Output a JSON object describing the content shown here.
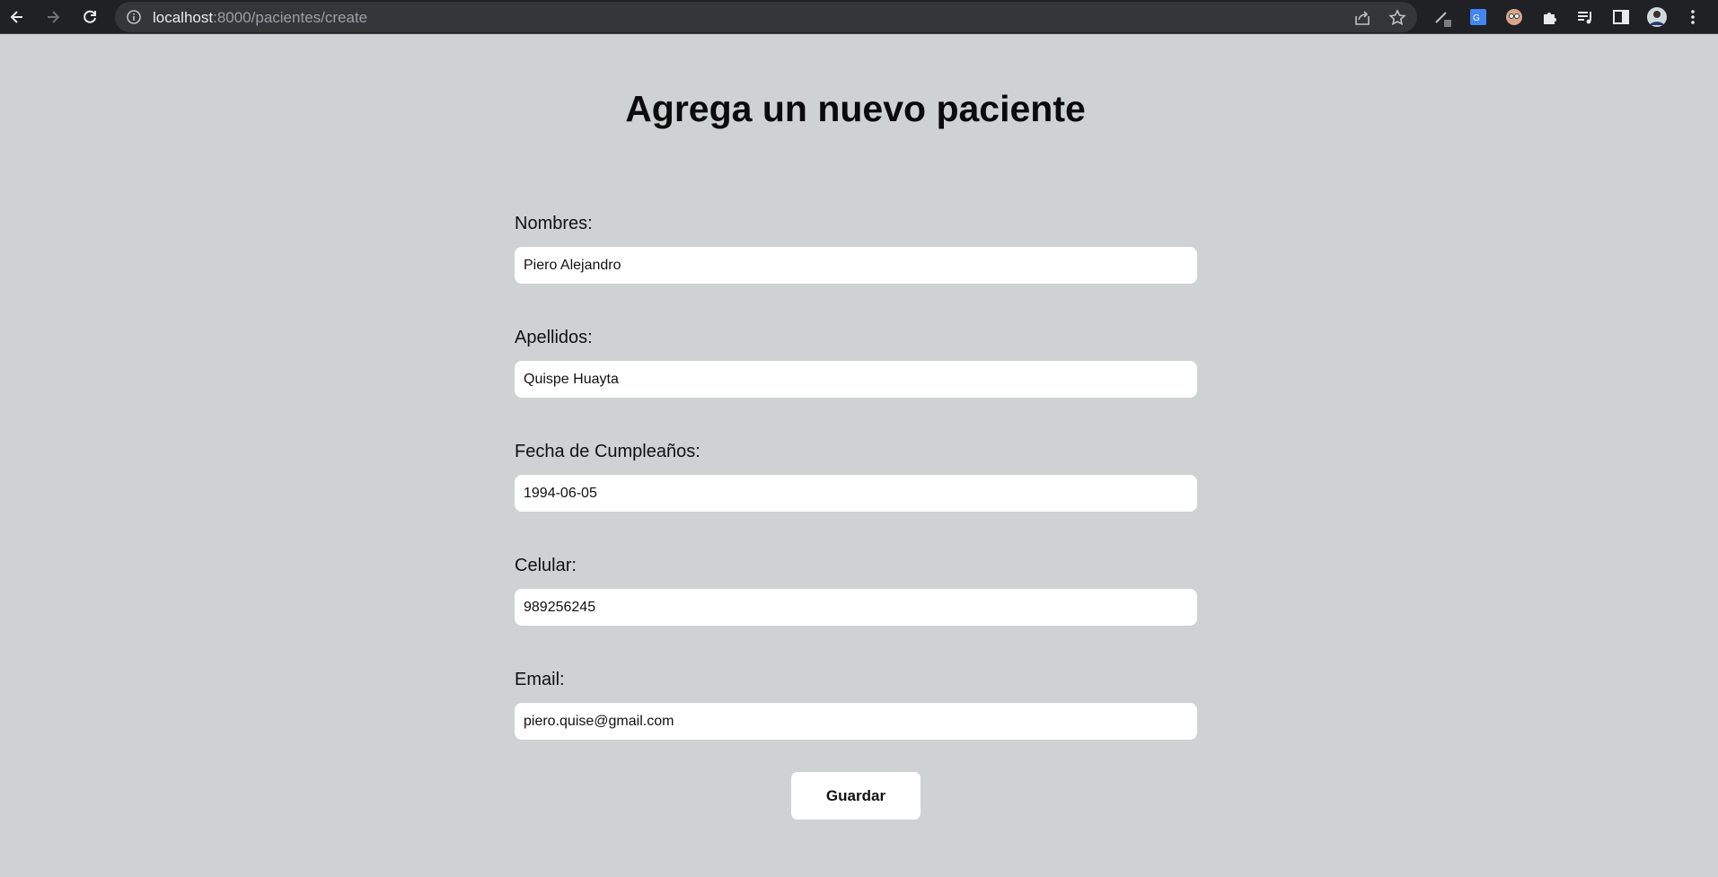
{
  "browser": {
    "url_host": "localhost",
    "url_rest": ":8000/pacientes/create",
    "icons": [
      "back-arrow-icon",
      "forward-arrow-icon",
      "reload-icon",
      "info-icon",
      "share-icon",
      "star-icon",
      "pen-icon",
      "translate-icon",
      "face-icon",
      "puzzle-icon",
      "media-icon",
      "sidepanel-icon",
      "avatar",
      "kebab-icon"
    ]
  },
  "page": {
    "title": "Agrega un nuevo paciente"
  },
  "form": {
    "nombres": {
      "label": "Nombres:",
      "value": "Piero Alejandro"
    },
    "apellidos": {
      "label": "Apellidos:",
      "value": "Quispe Huayta"
    },
    "fecha": {
      "label": "Fecha de Cumpleaños:",
      "value": "1994-06-05"
    },
    "celular": {
      "label": "Celular:",
      "value": "989256245"
    },
    "email": {
      "label": "Email:",
      "value": "piero.quise@gmail.com"
    },
    "submit_label": "Guardar"
  },
  "colors": {
    "page_bg": "#ced2d3",
    "chrome_bg": "#202124",
    "input_bg": "#ffffff"
  }
}
